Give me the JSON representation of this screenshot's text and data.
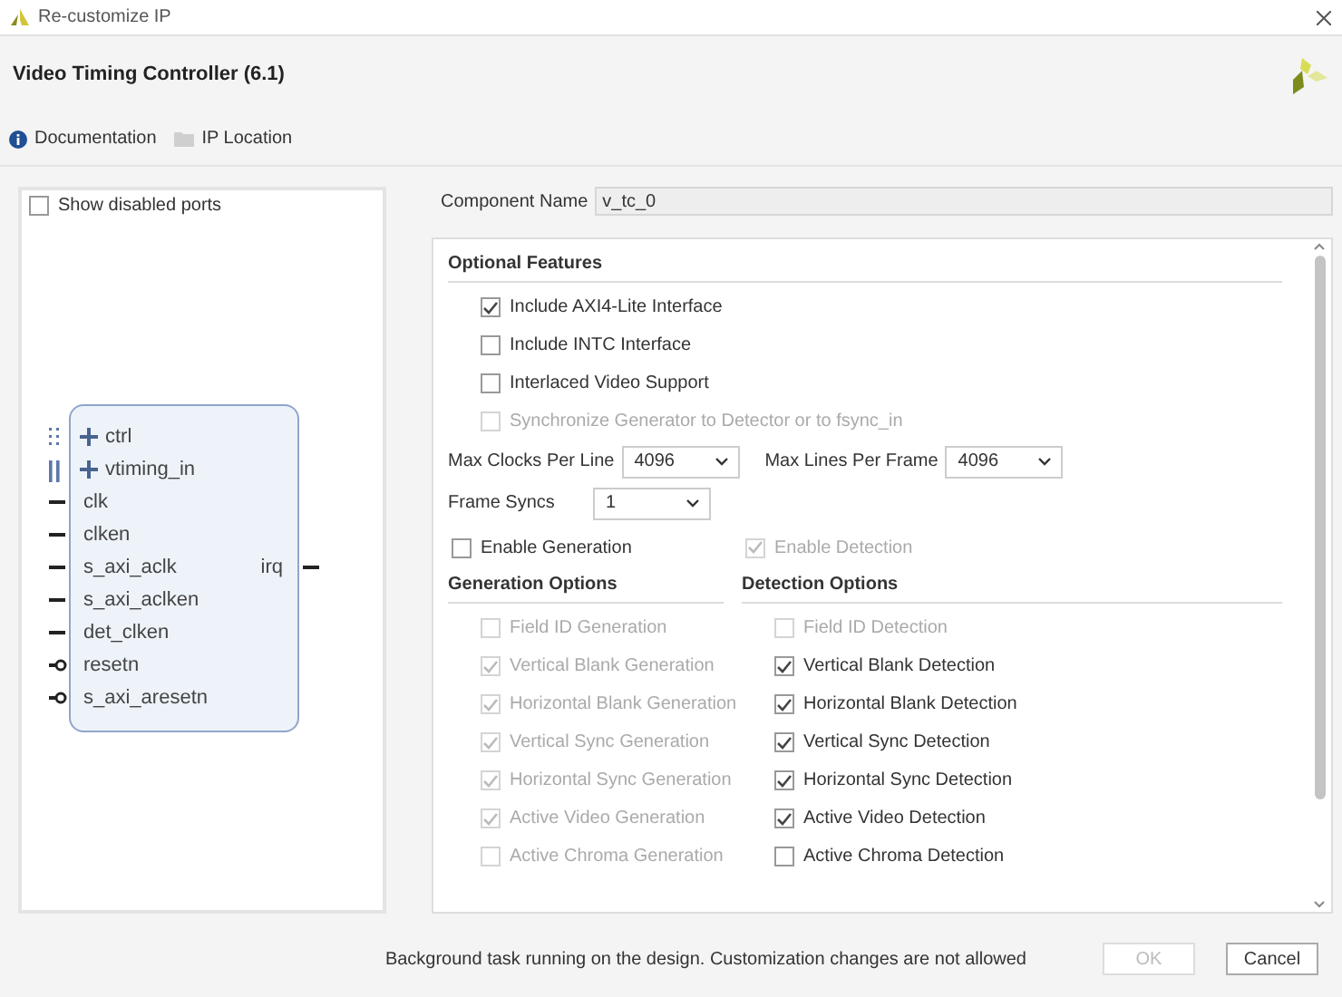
{
  "window": {
    "title": "Re-customize IP"
  },
  "header": {
    "title": "Video Timing Controller (6.1)"
  },
  "links": [
    {
      "label": "Documentation",
      "kind": "info"
    },
    {
      "label": "IP Location",
      "kind": "folder"
    }
  ],
  "symbol_panel": {
    "show_disabled_ports": {
      "label": "Show disabled ports",
      "checked": false
    },
    "ports_left": [
      {
        "name": "ctrl",
        "kind": "optional_bus"
      },
      {
        "name": "vtiming_in",
        "kind": "bus"
      },
      {
        "name": "clk",
        "kind": "wire"
      },
      {
        "name": "clken",
        "kind": "wire"
      },
      {
        "name": "s_axi_aclk",
        "kind": "wire"
      },
      {
        "name": "s_axi_aclken",
        "kind": "wire"
      },
      {
        "name": "det_clken",
        "kind": "wire"
      },
      {
        "name": "resetn",
        "kind": "reset"
      },
      {
        "name": "s_axi_aresetn",
        "kind": "reset"
      }
    ],
    "ports_right": [
      {
        "name": "irq",
        "kind": "wire"
      }
    ]
  },
  "component_name": {
    "label": "Component Name",
    "value": "v_tc_0"
  },
  "optional_features": {
    "title": "Optional Features",
    "options": [
      {
        "label": "Include AXI4-Lite Interface",
        "checked": true,
        "disabled": false
      },
      {
        "label": "Include INTC Interface",
        "checked": false,
        "disabled": false
      },
      {
        "label": "Interlaced Video Support",
        "checked": false,
        "disabled": false
      },
      {
        "label": "Synchronize Generator to Detector or to fsync_in",
        "checked": false,
        "disabled": true
      }
    ],
    "selects": [
      {
        "label": "Max Clocks Per Line",
        "value": "4096"
      },
      {
        "label": "Max Lines Per Frame",
        "value": "4096"
      },
      {
        "label": "Frame Syncs",
        "value": "1"
      }
    ],
    "enable": [
      {
        "label": "Enable Generation",
        "checked": false,
        "disabled": false
      },
      {
        "label": "Enable Detection",
        "checked": true,
        "disabled": true
      }
    ]
  },
  "generation_options": {
    "title": "Generation Options",
    "options": [
      {
        "label": "Field ID Generation",
        "checked": false,
        "disabled": true
      },
      {
        "label": "Vertical Blank Generation",
        "checked": true,
        "disabled": true
      },
      {
        "label": "Horizontal Blank Generation",
        "checked": true,
        "disabled": true
      },
      {
        "label": "Vertical Sync Generation",
        "checked": true,
        "disabled": true
      },
      {
        "label": "Horizontal Sync Generation",
        "checked": true,
        "disabled": true
      },
      {
        "label": "Active Video Generation",
        "checked": true,
        "disabled": true
      },
      {
        "label": "Active Chroma Generation",
        "checked": false,
        "disabled": true
      }
    ]
  },
  "detection_options": {
    "title": "Detection Options",
    "options": [
      {
        "label": "Field ID Detection",
        "checked": false,
        "disabled": true
      },
      {
        "label": "Vertical Blank Detection",
        "checked": true,
        "disabled": false
      },
      {
        "label": "Horizontal Blank Detection",
        "checked": true,
        "disabled": false
      },
      {
        "label": "Vertical Sync Detection",
        "checked": true,
        "disabled": false
      },
      {
        "label": "Horizontal Sync Detection",
        "checked": true,
        "disabled": false
      },
      {
        "label": "Active Video Detection",
        "checked": true,
        "disabled": false
      },
      {
        "label": "Active Chroma Detection",
        "checked": false,
        "disabled": false
      }
    ]
  },
  "status_message": "Background task running on the design. Customization changes are not allowed",
  "buttons": [
    {
      "label": "OK",
      "disabled": true
    },
    {
      "label": "Cancel",
      "disabled": false
    }
  ]
}
